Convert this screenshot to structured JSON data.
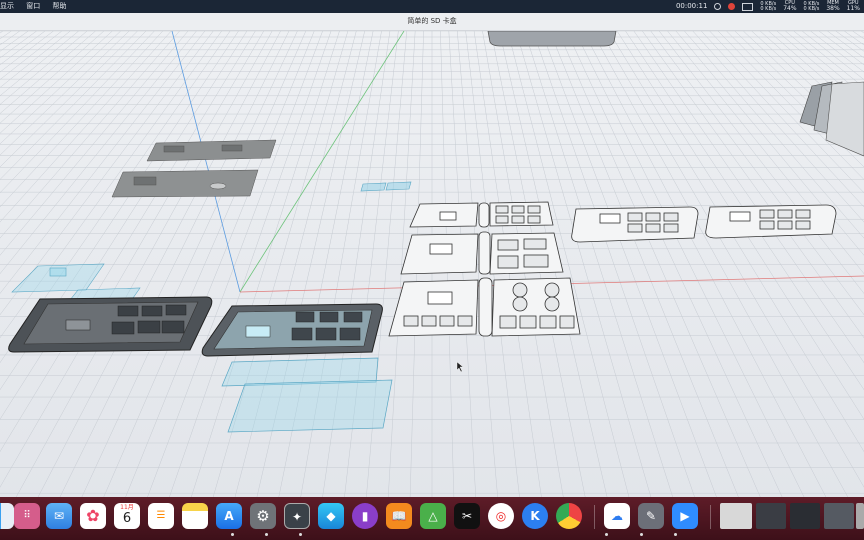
{
  "menubar": {
    "menus": [
      "显示",
      "窗口",
      "帮助"
    ],
    "timer": "00:00:11",
    "net_up": "0 KB/s",
    "net_down": "0 KB/s",
    "stat1_label": "CPU",
    "stat1_value": "74%",
    "stat2_label": "MEM",
    "stat2_value": "38%",
    "stat3_label": "GPU",
    "stat3_value": "11%"
  },
  "window": {
    "title": "简单的 SD 卡盒"
  },
  "dock": {
    "calendar_month": "11月",
    "calendar_day": "6",
    "apps": [
      "finder",
      "launchpad",
      "mail",
      "photos",
      "calendar",
      "reminders",
      "notes",
      "app-store",
      "system-settings",
      "shapr3d",
      "layers",
      "bookmarks",
      "books",
      "cad",
      "capcut",
      "netease-music",
      "kuaishou",
      "chrome",
      "baidu-netdisk",
      "games",
      "zoom"
    ]
  }
}
